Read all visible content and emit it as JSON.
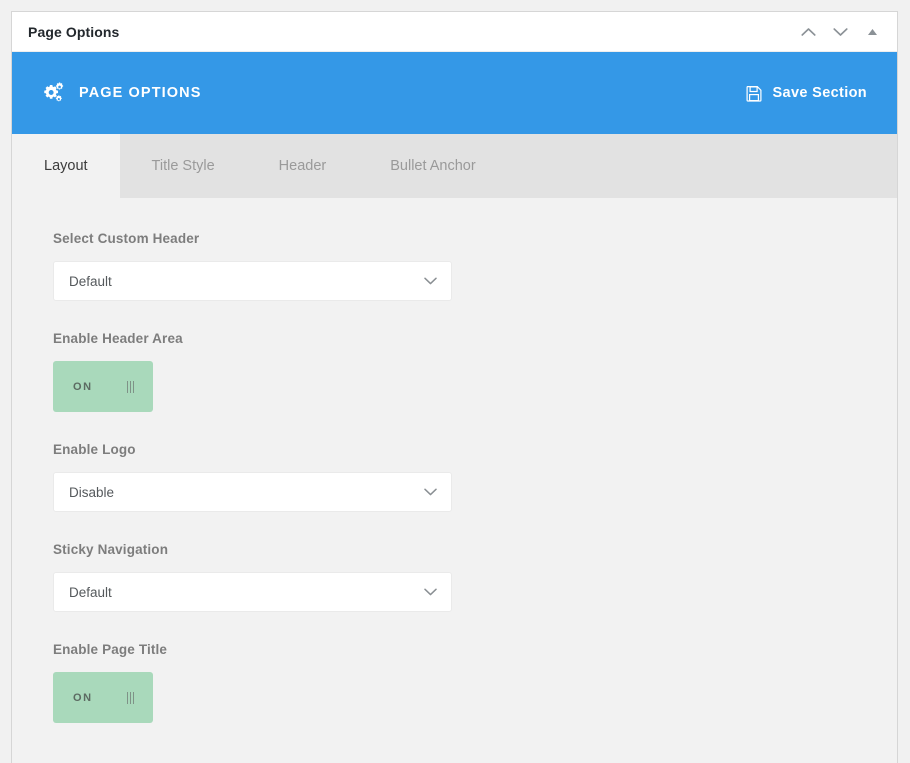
{
  "metabox": {
    "title": "Page Options",
    "handles": [
      {
        "name": "move-up-handle",
        "icon": "chevron-up-icon"
      },
      {
        "name": "move-down-handle",
        "icon": "chevron-down-icon"
      },
      {
        "name": "toggle-panel-handle",
        "icon": "triangle-up-icon"
      }
    ]
  },
  "section_header": {
    "icon": "cogs-icon",
    "title": "PAGE OPTIONS",
    "save_label": "Save Section",
    "save_icon": "save-floppy-icon",
    "accent_color": "#3498e7"
  },
  "tabs": [
    {
      "label": "Layout",
      "active": true
    },
    {
      "label": "Title Style",
      "active": false
    },
    {
      "label": "Header",
      "active": false
    },
    {
      "label": "Bullet Anchor",
      "active": false
    }
  ],
  "fields": [
    {
      "type": "select",
      "label": "Select Custom Header",
      "value": "Default",
      "name": "select-custom-header"
    },
    {
      "type": "toggle",
      "label": "Enable Header Area",
      "value": "ON",
      "name": "enable-header-area",
      "color": "#a9d9bb"
    },
    {
      "type": "select",
      "label": "Enable Logo",
      "value": "Disable",
      "name": "enable-logo"
    },
    {
      "type": "select",
      "label": "Sticky Navigation",
      "value": "Default",
      "name": "sticky-navigation"
    },
    {
      "type": "toggle",
      "label": "Enable Page Title",
      "value": "ON",
      "name": "enable-page-title",
      "color": "#a9d9bb"
    }
  ]
}
